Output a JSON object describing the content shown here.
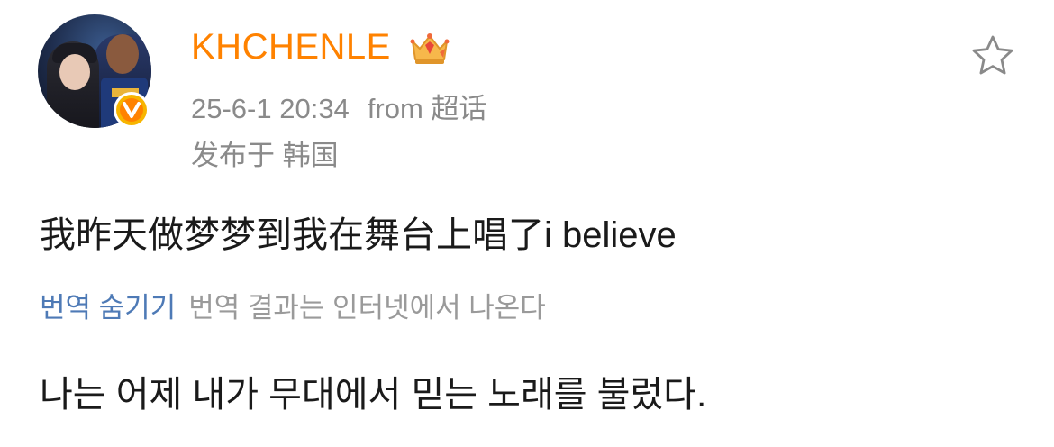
{
  "post": {
    "username": "KHCHENLE",
    "timestamp": "25-6-1 20:34",
    "source": "from 超话",
    "location": "发布于 韩国",
    "text": "我昨天做梦梦到我在舞台上唱了i believe",
    "translation": {
      "hide_label": "번역 숨기기",
      "note": "번역 결과는 인터넷에서 나온다",
      "text": "나는 어제 내가 무대에서 믿는 노래를 불렀다."
    }
  },
  "icons": {
    "avatar": "user-avatar",
    "badge": "verified-v-badge",
    "crown": "crown-icon",
    "favorite": "star-outline-icon"
  },
  "colors": {
    "username": "#ff8200",
    "meta": "#8a8a8a",
    "link": "#4e7ab6",
    "text": "#1a1a1a"
  }
}
